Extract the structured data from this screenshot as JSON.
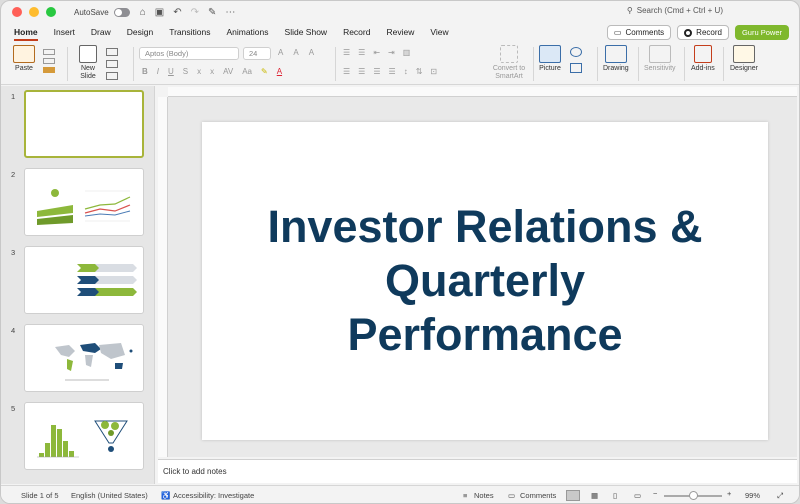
{
  "titlebar": {
    "autosave_label": "AutoSave",
    "search_placeholder": "Search (Cmd + Ctrl + U)"
  },
  "tabs": [
    "Home",
    "Insert",
    "Draw",
    "Design",
    "Transitions",
    "Animations",
    "Slide Show",
    "Record",
    "Review",
    "View"
  ],
  "top_right": {
    "comments_label": "Comments",
    "record_label": "Record",
    "guru_label": "Guru Power"
  },
  "ribbon": {
    "paste_label": "Paste",
    "new_slide_label": "New Slide",
    "font_name": "Aptos (Body)",
    "font_size": "24",
    "convert_label": "Convert to SmartArt",
    "picture_label": "Picture",
    "drawing_label": "Drawing",
    "sensitivity_label": "Sensitivity",
    "addins_label": "Add-ins",
    "designer_label": "Designer"
  },
  "slides": [
    {
      "number": "1",
      "selected": true
    },
    {
      "number": "2"
    },
    {
      "number": "3"
    },
    {
      "number": "4"
    },
    {
      "number": "5"
    }
  ],
  "slide": {
    "title": "Investor Relations & Quarterly Performance"
  },
  "notes_placeholder": "Click to add notes",
  "status": {
    "slide_of": "Slide 1 of 5",
    "language": "English (United States)",
    "accessibility": "Accessibility: Investigate",
    "notes_label": "Notes",
    "comments_label": "Comments",
    "zoom": "99%"
  },
  "colors": {
    "accent_tab": "#c43e1c",
    "title_text": "#0f3a5c",
    "green": "#8db83b",
    "navy": "#1f4e79"
  }
}
